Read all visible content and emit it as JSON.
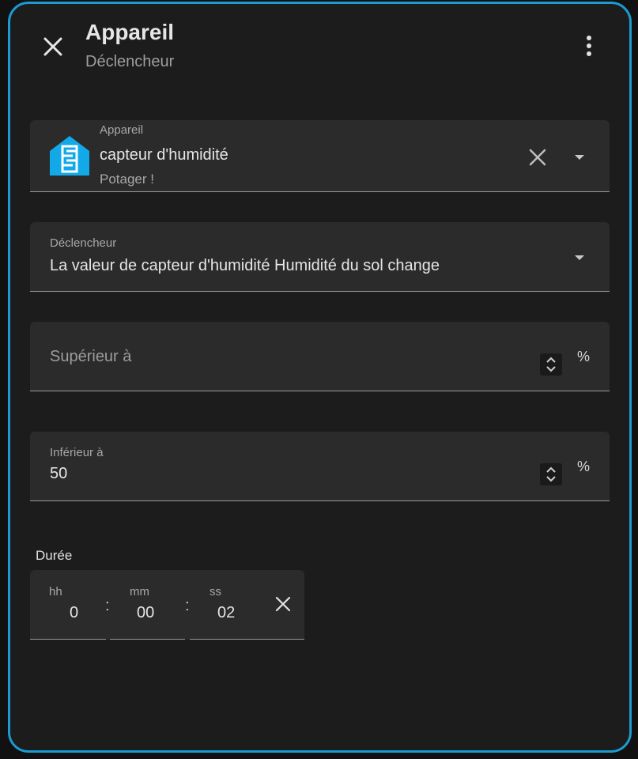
{
  "header": {
    "title": "Appareil",
    "subtitle": "Déclencheur",
    "close_icon": "close-icon",
    "menu_icon": "more-vertical-icon"
  },
  "device": {
    "label": "Appareil",
    "value": "capteur d'humidité",
    "area": "Potager !",
    "icon": "home-sensor-icon",
    "icon_color": "#12a9e8"
  },
  "trigger": {
    "label": "Déclencheur",
    "value": "La valeur de capteur d'humidité Humidité du sol change"
  },
  "above": {
    "placeholder": "Supérieur à",
    "unit": "%"
  },
  "below": {
    "label": "Inférieur à",
    "value": "50",
    "unit": "%"
  },
  "duration": {
    "label": "Durée",
    "hours_label": "hh",
    "hours": "0",
    "minutes_label": "mm",
    "minutes": "00",
    "seconds_label": "ss",
    "seconds": "02",
    "separator": ":"
  },
  "colors": {
    "accent_border": "#1b9bd1",
    "dialog_bg": "#1c1c1c",
    "field_bg": "#2b2b2b"
  }
}
